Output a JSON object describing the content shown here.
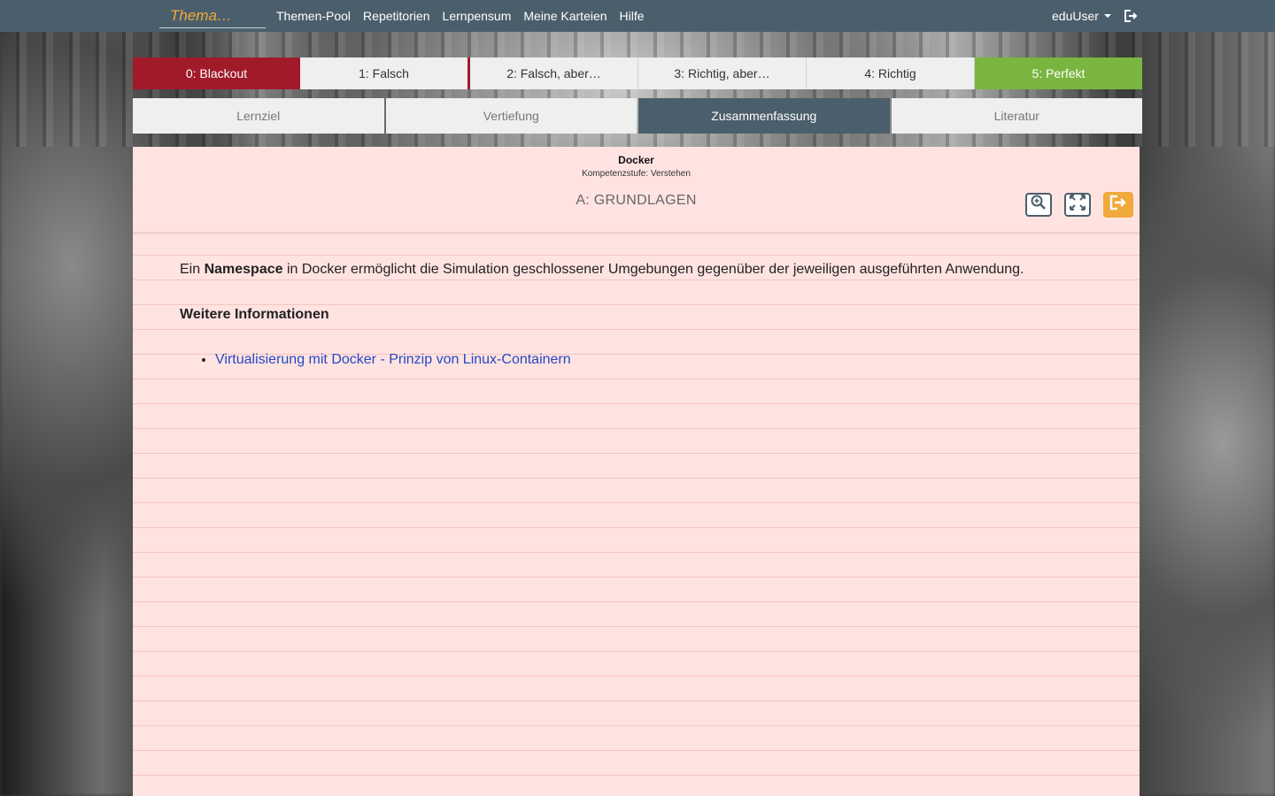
{
  "navbar": {
    "brand": "Thema…",
    "links": [
      "Themen-Pool",
      "Repetitorien",
      "Lernpensum",
      "Meine Karteien",
      "Hilfe"
    ],
    "user": "eduUser"
  },
  "rating": {
    "buttons": [
      "0: Blackout",
      "1: Falsch",
      "2: Falsch, aber…",
      "3: Richtig, aber…",
      "4: Richtig",
      "5: Perfekt"
    ],
    "colors": {
      "blackout": "#a11a2a",
      "perfekt": "#7ab540"
    }
  },
  "tabs": {
    "items": [
      "Lernziel",
      "Vertiefung",
      "Zusammenfassung",
      "Literatur"
    ],
    "active": "Zusammenfassung"
  },
  "card": {
    "title": "Docker",
    "subtitle": "Kompetenzstufe: Verstehen",
    "section": "A: GRUNDLAGEN",
    "text_before": "Ein ",
    "text_bold": "Namespace",
    "text_after": " in Docker ermöglicht die Simulation geschlossener Umgebungen gegenüber der jeweiligen ausgeführten Anwendung.",
    "further_heading": "Weitere Informationen",
    "links": [
      "Virtualisierung mit Docker - Prinzip von Linux-Containern"
    ],
    "background": "#ffe3e1",
    "tools": [
      "zoom-icon",
      "fullscreen-icon",
      "exit-icon"
    ]
  }
}
